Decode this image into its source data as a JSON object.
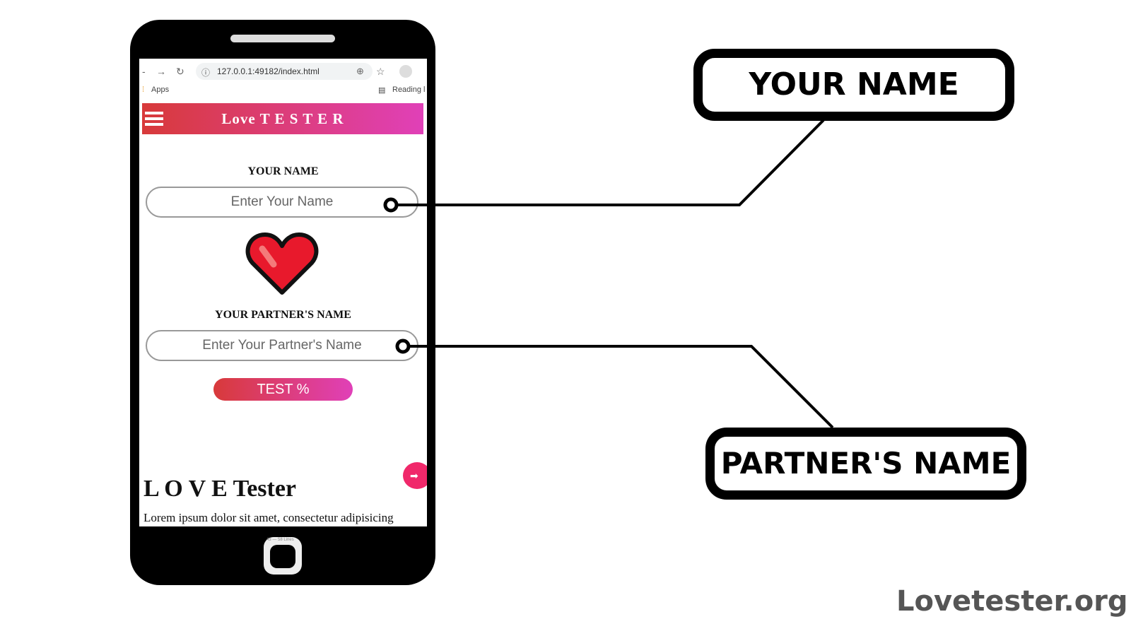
{
  "browser": {
    "url": "127.0.0.1:49182/index.html",
    "bookmarks_apps": "Apps",
    "reading_list": "Reading l"
  },
  "app": {
    "title": "Love T E S T E R",
    "your_name_label": "YOUR NAME",
    "your_name_placeholder": "Enter Your Name",
    "partner_label": "YOUR PARTNER'S NAME",
    "partner_placeholder": "Enter Your Partner's Name",
    "test_button": "TEST %",
    "heading": "L O V E Tester",
    "paragraph": "Lorem ipsum dolor sit amet, consectetur adipisicing",
    "home_overlay": "43 — 58 Lines"
  },
  "callouts": {
    "your_name": "YOUR NAME",
    "partner_name": "PARTNER'S NAME"
  },
  "watermark": "Lovetester.org",
  "colors": {
    "gradient_start": "#d83a3a",
    "gradient_end": "#e040b8",
    "heart": "#e8192c",
    "fab": "#f0286a"
  }
}
